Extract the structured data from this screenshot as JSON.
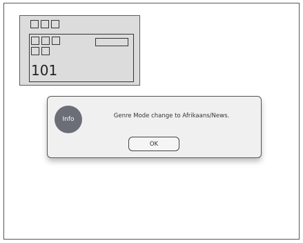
{
  "channel_panel": {
    "channel_number": "101"
  },
  "dialog": {
    "icon_label": "Info",
    "message": "Genre Mode change to Afrikaans/News.",
    "ok_label": "OK"
  }
}
